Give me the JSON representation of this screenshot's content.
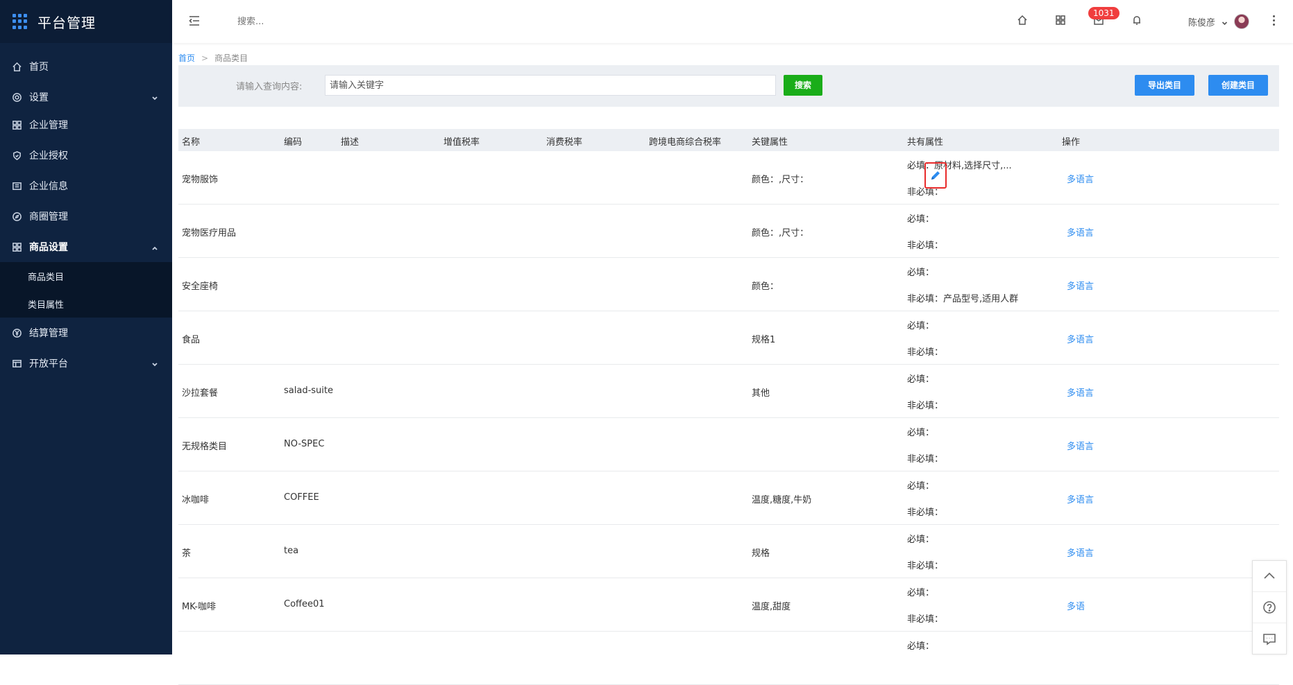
{
  "app": {
    "title": "平台管理"
  },
  "header": {
    "search_placeholder": "搜索...",
    "badge_count": "1031",
    "user_name": "陈俊彦"
  },
  "sidebar": {
    "items": [
      {
        "label": "首页",
        "icon": "home-icon"
      },
      {
        "label": "设置",
        "icon": "gear-icon"
      },
      {
        "label": "企业管理",
        "icon": "org-icon"
      },
      {
        "label": "企业授权",
        "icon": "shield-icon"
      },
      {
        "label": "企业信息",
        "icon": "info-card-icon"
      },
      {
        "label": "商圈管理",
        "icon": "compass-icon"
      },
      {
        "label": "商品设置",
        "icon": "grid-icon"
      },
      {
        "label": "结算管理",
        "icon": "yen-icon"
      },
      {
        "label": "开放平台",
        "icon": "table-icon"
      }
    ],
    "sub_items": [
      "商品类目",
      "类目属性"
    ]
  },
  "breadcrumb": {
    "home": "首页",
    "separator": ">",
    "current": "商品类目"
  },
  "filter": {
    "label": "请输入查询内容:",
    "placeholder": "请输入关键字",
    "search_label": "搜索",
    "export_label": "导出类目",
    "create_label": "创建类目"
  },
  "table": {
    "headers": [
      "名称",
      "编码",
      "描述",
      "增值税率",
      "消费税率",
      "跨境电商综合税率",
      "关键属性",
      "共有属性",
      "操作"
    ],
    "rows": [
      {
        "name": "宠物服饰",
        "code": "",
        "key_attr": "颜色：,尺寸：",
        "must": "必填：原材料,选择尺寸,...",
        "optional": "非必填：",
        "action": "多语言"
      },
      {
        "name": "宠物医疗用品",
        "code": "",
        "key_attr": "颜色：,尺寸：",
        "must": "必填：",
        "optional": "非必填：",
        "action": "多语言"
      },
      {
        "name": "安全座椅",
        "code": "",
        "key_attr": "颜色：",
        "must": "必填：",
        "optional": "非必填：产品型号,适用人群",
        "action": "多语言"
      },
      {
        "name": "食品",
        "code": "",
        "key_attr": "规格1",
        "must": "必填：",
        "optional": "非必填：",
        "action": "多语言"
      },
      {
        "name": "沙拉套餐",
        "code": "salad-suite",
        "key_attr": "其他",
        "must": "必填：",
        "optional": "非必填：",
        "action": "多语言"
      },
      {
        "name": "无规格类目",
        "code": "NO-SPEC",
        "key_attr": "",
        "must": "必填：",
        "optional": "非必填：",
        "action": "多语言"
      },
      {
        "name": "冰咖啡",
        "code": "COFFEE",
        "key_attr": "温度,糖度,牛奶",
        "must": "必填：",
        "optional": "非必填：",
        "action": "多语言"
      },
      {
        "name": "茶",
        "code": "tea",
        "key_attr": "规格",
        "must": "必填：",
        "optional": "非必填：",
        "action": "多语言"
      },
      {
        "name": "MK-咖啡",
        "code": "Coffee01",
        "key_attr": "温度,甜度",
        "must": "必填：",
        "optional": "非必填：",
        "action": "多语"
      },
      {
        "name": "",
        "code": "",
        "key_attr": "",
        "must": "必填：",
        "optional": "",
        "action": ""
      }
    ]
  },
  "colors": {
    "sidebar_bg": "#0f2340",
    "accent": "#2d8cf0",
    "search_green": "#1aad19",
    "badge_red": "#f03e3e"
  }
}
